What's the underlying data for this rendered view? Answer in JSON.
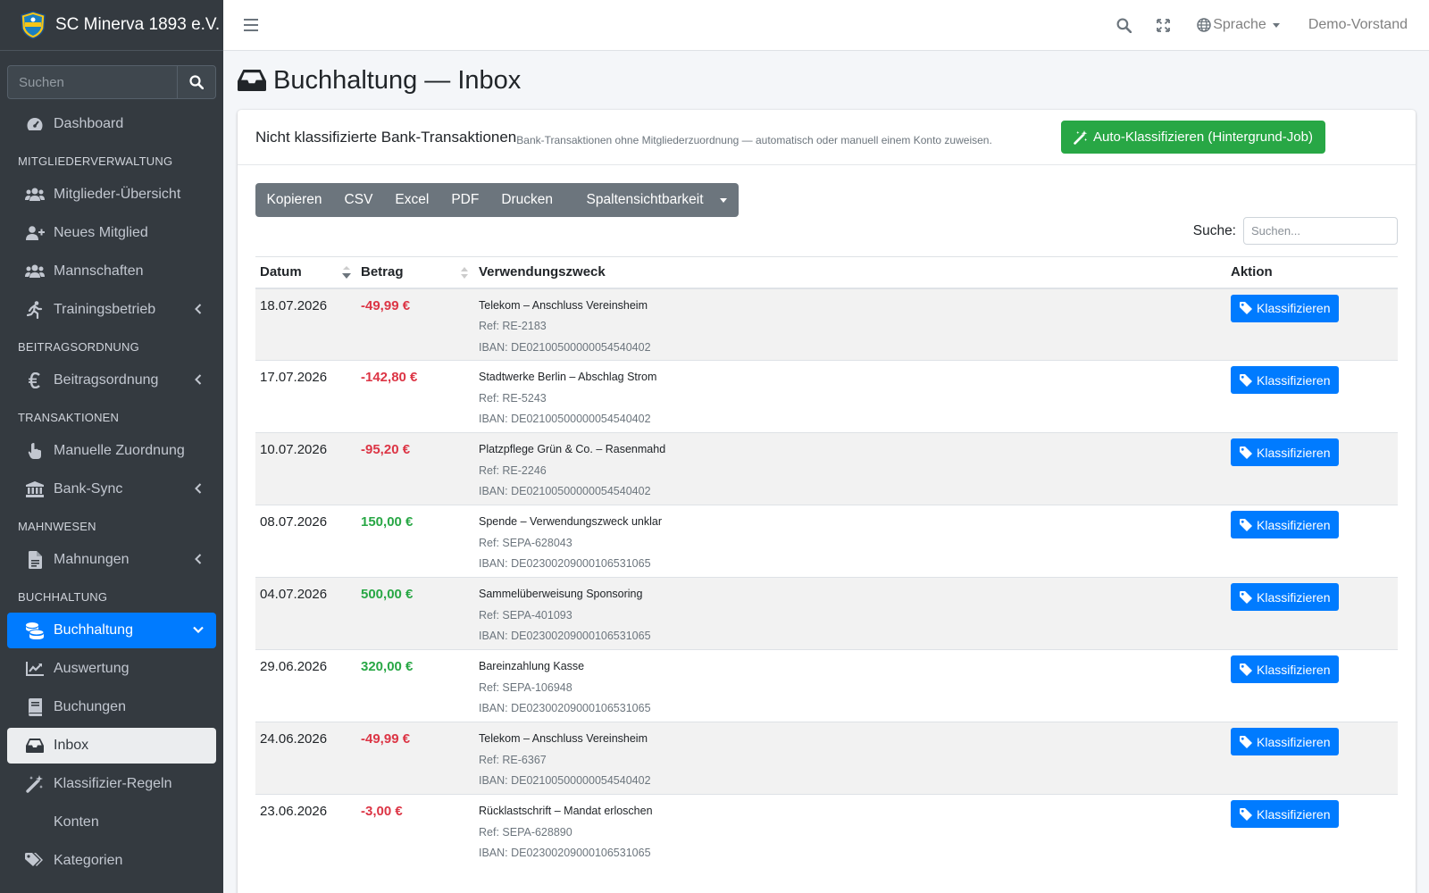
{
  "app": {
    "brand": "SC Minerva 1893 e.V.",
    "search_placeholder": "Suchen"
  },
  "sidebar": {
    "dashboard": "Dashboard",
    "sections": {
      "members": "Mitgliederverwaltung",
      "fees": "Beitragsordnung",
      "transactions": "Transaktionen",
      "dunning": "Mahnwesen",
      "accounting": "Buchhaltung"
    },
    "items": {
      "members_overview": "Mitglieder-Übersicht",
      "new_member": "Neues Mitglied",
      "teams": "Mannschaften",
      "training": "Trainingsbetrieb",
      "fee_order": "Beitragsordnung",
      "manual_assign": "Manuelle Zuordnung",
      "bank_sync": "Bank-Sync",
      "reminders": "Mahnungen",
      "accounting": "Buchhaltung",
      "evaluation": "Auswertung",
      "bookings": "Buchungen",
      "inbox": "Inbox",
      "class_rules": "Klassifizier-Regeln",
      "accounts": "Konten",
      "categories": "Kategorien"
    }
  },
  "topbar": {
    "language": "Sprache",
    "user": "Demo-Vorstand"
  },
  "page": {
    "title": "Buchhaltung — Inbox",
    "card_title": "Nicht klassifizierte Bank-Transaktionen",
    "card_subtitle": "Bank-Transaktionen ohne Mitgliederzuordnung — automatisch oder manuell einem Konto zuweisen.",
    "auto_button": "Auto-Klassifizieren (Hintergrund-Job)"
  },
  "toolbar": {
    "copy": "Kopieren",
    "csv": "CSV",
    "excel": "Excel",
    "pdf": "PDF",
    "print": "Drucken",
    "columns": "Spaltensichtbarkeit"
  },
  "table": {
    "search_label": "Suche:",
    "search_placeholder": "Suchen...",
    "columns": [
      "Datum",
      "Betrag",
      "Verwendungszweck",
      "Aktion"
    ],
    "action_label": "Klassifizieren",
    "rows": [
      {
        "date": "18.07.2026",
        "amount": "-49,99 €",
        "sign": "neg",
        "purpose": "Telekom – Anschluss Vereinsheim",
        "ref": "Ref: RE-2183",
        "iban": "IBAN: DE02100500000054540402"
      },
      {
        "date": "17.07.2026",
        "amount": "-142,80 €",
        "sign": "neg",
        "purpose": "Stadtwerke Berlin – Abschlag Strom",
        "ref": "Ref: RE-5243",
        "iban": "IBAN: DE02100500000054540402"
      },
      {
        "date": "10.07.2026",
        "amount": "-95,20 €",
        "sign": "neg",
        "purpose": "Platzpflege Grün & Co. – Rasenmahd",
        "ref": "Ref: RE-2246",
        "iban": "IBAN: DE02100500000054540402"
      },
      {
        "date": "08.07.2026",
        "amount": "150,00 €",
        "sign": "pos",
        "purpose": "Spende – Verwendungszweck unklar",
        "ref": "Ref: SEPA-628043",
        "iban": "IBAN: DE02300209000106531065"
      },
      {
        "date": "04.07.2026",
        "amount": "500,00 €",
        "sign": "pos",
        "purpose": "Sammelüberweisung Sponsoring",
        "ref": "Ref: SEPA-401093",
        "iban": "IBAN: DE02300209000106531065"
      },
      {
        "date": "29.06.2026",
        "amount": "320,00 €",
        "sign": "pos",
        "purpose": "Bareinzahlung Kasse",
        "ref": "Ref: SEPA-106948",
        "iban": "IBAN: DE02300209000106531065"
      },
      {
        "date": "24.06.2026",
        "amount": "-49,99 €",
        "sign": "neg",
        "purpose": "Telekom – Anschluss Vereinsheim",
        "ref": "Ref: RE-6367",
        "iban": "IBAN: DE02100500000054540402"
      },
      {
        "date": "23.06.2026",
        "amount": "-3,00 €",
        "sign": "neg",
        "purpose": "Rücklastschrift – Mandat erloschen",
        "ref": "Ref: SEPA-628890",
        "iban": "IBAN: DE02300209000106531065"
      }
    ]
  },
  "colors": {
    "sidebar_bg": "#343a40",
    "primary": "#007bff",
    "success": "#28a745",
    "danger": "#dc3545",
    "secondary": "#6c757d"
  }
}
